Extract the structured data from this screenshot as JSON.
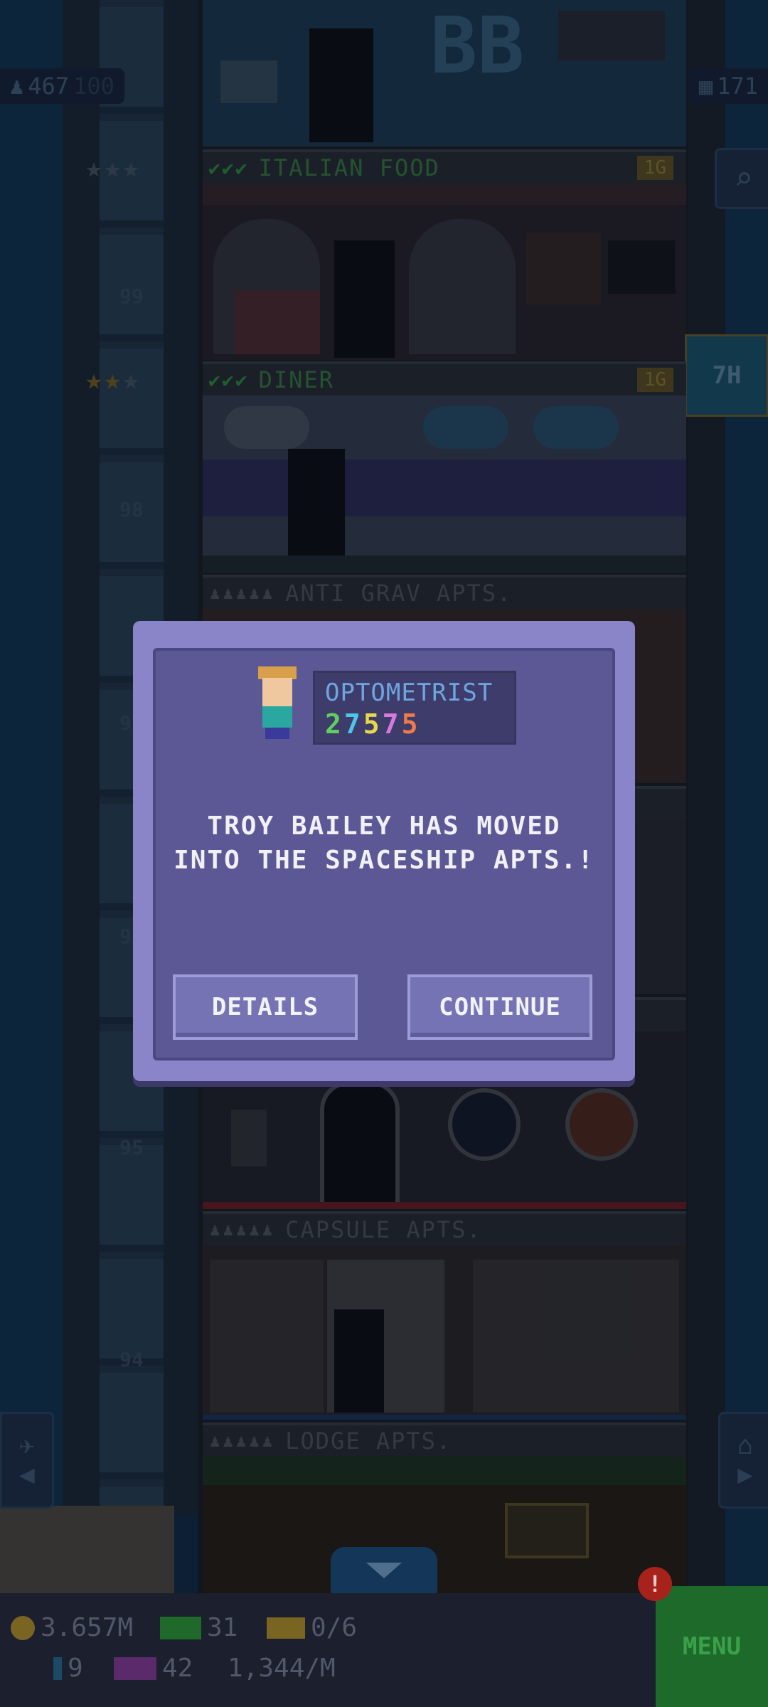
{
  "hud": {
    "population": "467",
    "population_ghost": "100",
    "floors": "171",
    "elevator_time": "7H"
  },
  "floors": {
    "elevator_numbers": [
      "99",
      "98",
      "97",
      "96",
      "95",
      "94"
    ],
    "rows": [
      {
        "name": "ITALIAN FOOD",
        "checks": "✔✔✔",
        "price": "1G",
        "type": "food"
      },
      {
        "name": "DINER",
        "checks": "✔✔✔",
        "price": "1G",
        "type": "food"
      },
      {
        "name": "ANTI GRAV APTS.",
        "persons": "♟♟♟♟♟",
        "type": "residential"
      },
      {
        "name": "CAPSULE APTS.",
        "persons": "♟♟♟♟♟",
        "type": "residential"
      },
      {
        "name": "LODGE APTS.",
        "persons": "♟♟♟♟♟",
        "type": "residential"
      }
    ],
    "sign_letters": "BB"
  },
  "dialog": {
    "job_title": "OPTOMETRIST",
    "job_number": [
      "2",
      "7",
      "5",
      "7",
      "5"
    ],
    "number_colors": [
      "#5fd05f",
      "#4ec4e6",
      "#e8d84a",
      "#d57adf",
      "#ef7a4a"
    ],
    "message": "TROY BAILEY HAS MOVED\nINTO THE SPACESHIP APTS.!",
    "details_label": "DETAILS",
    "continue_label": "CONTINUE"
  },
  "bottom": {
    "coins": "3.657M",
    "bux": "31",
    "tickets": "0/6",
    "keys": "9",
    "vip": "42",
    "rate": "1,344/M",
    "menu_label": "MENU",
    "alert": "!"
  },
  "colors": {
    "accent_green": "#2fa23f",
    "dialog_bg": "#5b5895",
    "menu_green": "#1e6a2a"
  }
}
